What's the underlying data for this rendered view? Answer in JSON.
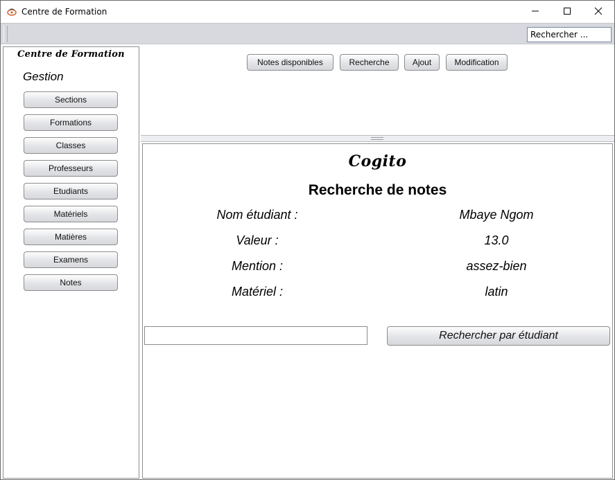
{
  "window": {
    "title": "Centre de Formation",
    "icons": {
      "app": "app-logo-icon",
      "minimize": "minimize-icon",
      "maximize": "maximize-icon",
      "close": "close-icon"
    }
  },
  "toolbar": {
    "search_value": "Rechercher ..."
  },
  "sidebar": {
    "brand": "Centre de Formation",
    "section_title": "Gestion",
    "items": [
      {
        "label": "Sections"
      },
      {
        "label": "Formations"
      },
      {
        "label": "Classes"
      },
      {
        "label": "Professeurs"
      },
      {
        "label": "Etudiants"
      },
      {
        "label": "Matériels"
      },
      {
        "label": "Matières"
      },
      {
        "label": "Examens"
      },
      {
        "label": "Notes"
      }
    ]
  },
  "actions": {
    "buttons": [
      {
        "label": "Notes disponibles"
      },
      {
        "label": "Recherche"
      },
      {
        "label": "Ajout"
      },
      {
        "label": "Modification"
      }
    ]
  },
  "content": {
    "brand": "Cogito",
    "heading": "Recherche de notes",
    "fields": [
      {
        "label": "Nom étudiant :",
        "value": "Mbaye Ngom"
      },
      {
        "label": "Valeur :",
        "value": "13.0"
      },
      {
        "label": "Mention :",
        "value": "assez-bien"
      },
      {
        "label": "Matériel :",
        "value": "latin"
      }
    ],
    "student_input_value": "",
    "search_button_label": "Rechercher par étudiant"
  },
  "colors": {
    "toolbar_bg": "#d7d9de",
    "app_icon_accent": "#d9541e"
  }
}
